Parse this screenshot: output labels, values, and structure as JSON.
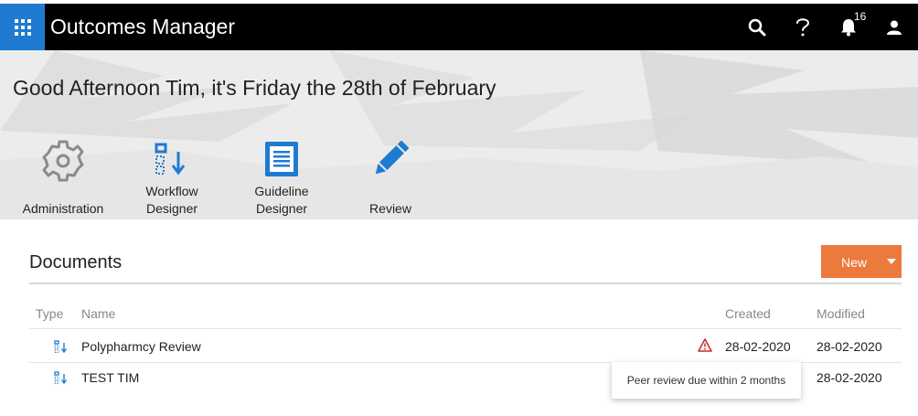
{
  "header": {
    "app_title": "Outcomes Manager",
    "notification_count": "16",
    "icons": [
      "apps-grid-icon",
      "search-icon",
      "help-icon",
      "bell-icon",
      "user-icon"
    ]
  },
  "hero": {
    "greeting": "Good Afternoon Tim, it's Friday the 28th of February",
    "tiles": [
      {
        "line1": "",
        "line2": "Administration",
        "icon": "gear-icon"
      },
      {
        "line1": "Workflow",
        "line2": "Designer",
        "icon": "workflow-icon"
      },
      {
        "line1": "Guideline",
        "line2": "Designer",
        "icon": "document-icon"
      },
      {
        "line1": "",
        "line2": "Review",
        "icon": "pencil-icon"
      }
    ]
  },
  "documents": {
    "title": "Documents",
    "new_label": "New",
    "columns": {
      "type": "Type",
      "name": "Name",
      "created": "Created",
      "modified": "Modified"
    },
    "rows": [
      {
        "name": "Polypharmcy Review",
        "created": "28-02-2020",
        "modified": "28-02-2020",
        "icon": "workflow-icon",
        "warning": true
      },
      {
        "name": "TEST TIM",
        "created": "",
        "modified": "28-02-2020",
        "icon": "workflow-icon",
        "warning": false
      }
    ],
    "tooltip": "Peer review due within 2 months"
  },
  "colors": {
    "topbar": "#000000",
    "apps_button": "#1f7ad1",
    "icon_blue": "#1f7ad1",
    "new_button": "#ec7a3c",
    "warning": "#c62828"
  }
}
